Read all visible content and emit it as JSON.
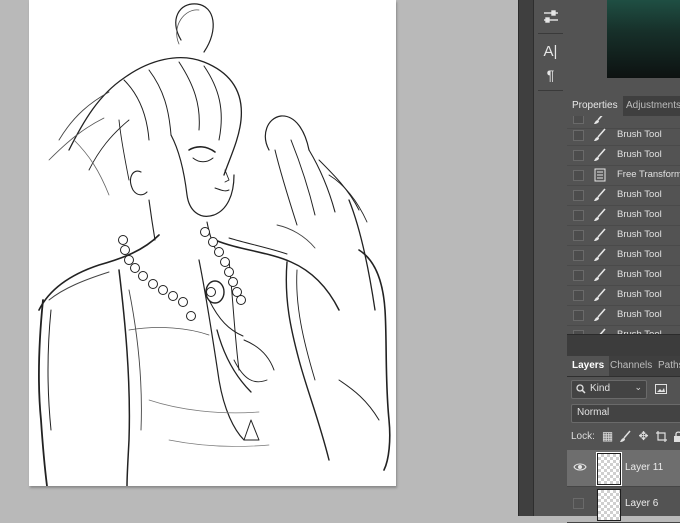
{
  "app": {
    "accent_color": "#535353"
  },
  "toolbar": {
    "icons": [
      "sliders-icon",
      "character-text-icon",
      "paragraph-icon"
    ],
    "character_glyph": "A|",
    "paragraph_glyph": "¶"
  },
  "top_panel": {
    "tabs": [
      {
        "label": "Properties",
        "active": true
      },
      {
        "label": "Adjustments",
        "active": false
      }
    ]
  },
  "history": {
    "items": [
      {
        "label": "Brush Tool",
        "icon": "brush-icon"
      },
      {
        "label": "Brush Tool",
        "icon": "brush-icon"
      },
      {
        "label": "Free Transform",
        "icon": "transform-document-icon"
      },
      {
        "label": "Brush Tool",
        "icon": "brush-icon"
      },
      {
        "label": "Brush Tool",
        "icon": "brush-icon"
      },
      {
        "label": "Brush Tool",
        "icon": "brush-icon"
      },
      {
        "label": "Brush Tool",
        "icon": "brush-icon"
      },
      {
        "label": "Brush Tool",
        "icon": "brush-icon"
      },
      {
        "label": "Brush Tool",
        "icon": "brush-icon"
      },
      {
        "label": "Brush Tool",
        "icon": "brush-icon"
      },
      {
        "label": "Brush Tool",
        "icon": "brush-icon"
      }
    ]
  },
  "layers_panel": {
    "tabs": [
      {
        "label": "Layers",
        "active": true
      },
      {
        "label": "Channels",
        "active": false
      },
      {
        "label": "Paths",
        "active": false
      }
    ],
    "filter_kind": "Kind",
    "blend_mode": "Normal",
    "lock_label": "Lock:",
    "layers": [
      {
        "name": "Layer 11",
        "visible": true,
        "selected": true
      },
      {
        "name": "Layer 6",
        "visible": false,
        "selected": false
      }
    ]
  }
}
